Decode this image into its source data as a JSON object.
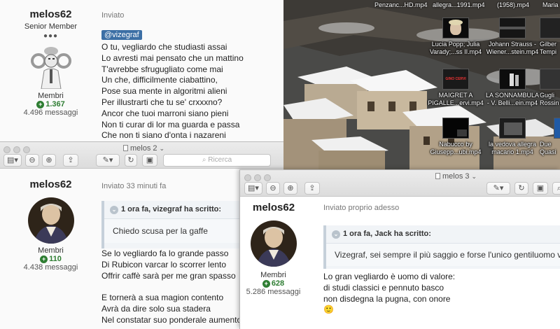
{
  "desktop": {
    "top_labels": [
      "Penzanc...HD.mp4",
      "allegra...1991.mp4",
      "(1958).mp4",
      "Maria"
    ],
    "icons": [
      {
        "label1": "Lucia Popp; Julia",
        "label2": "Varady;...ss II.mp4"
      },
      {
        "label1": "Johann Strauss -",
        "label2": "Wiener...stein.mp4"
      },
      {
        "label1": "Gilber",
        "label2": "Tempi"
      },
      {
        "label1": "MAIGRET A",
        "label2": "PIGALLE...ervi.mp4",
        "thumb_text": "GINO CERVI"
      },
      {
        "label1": "LA SONNAMBULA",
        "label2": "- V. Belli...ein.mp4"
      },
      {
        "label1": "Gugli",
        "label2": "Rossin"
      },
      {
        "label1": "Nabucco by",
        "label2": "Giusepp...ubi.mp4"
      },
      {
        "label1": "la vedova allegra",
        "label2": "macario 1.mp4"
      },
      {
        "label1": "Due",
        "label2": "Quasi"
      }
    ]
  },
  "window1": {
    "username": "melos62",
    "rank": "Senior Member",
    "pips": "●●●",
    "group": "Membri",
    "reputation": "1.367",
    "messages": "4.496 messaggi",
    "sent": "Inviato",
    "mention": "@vizegraf",
    "lines": [
      "O tu, vegliardo che studiasti assai",
      "Lo avresti mai pensato che un mattino",
      "T'avrebbe sfrugugliato come mai",
      "Un che, difficilmente ciabattino,",
      "Pose sua mente in algoritmi alieni",
      "Per illustrarti che tu se' crxxxno?",
      "Ancor che tuoi marroni siano pieni",
      "Non ti curar di lor ma guarda e passa",
      "Che non ti siano d'onta i nazareni"
    ]
  },
  "window2": {
    "title": "melos 2",
    "search": "Ricerca",
    "username": "melos62",
    "group": "Membri",
    "reputation": "110",
    "messages": "4.438 messaggi",
    "sent": "Inviato 33 minuti fa",
    "quote_header": "1 ora fa, vizegraf ha scritto:",
    "quote_body": "Chiedo scusa per la gaffe",
    "lines": [
      "Se lo vegliardo fa lo grande passo",
      "Di Rubicon varcar lo scorrer lento",
      "Offrir caffè sarà per me gran spasso",
      "",
      "E tornerà a sua magion contento",
      "Avrà da dire solo sua stadera",
      "Nel constatar suo ponderale aumento"
    ]
  },
  "window3": {
    "title": "melos 3",
    "username": "melos62",
    "group": "Membri",
    "reputation": "628",
    "messages": "5.286 messaggi",
    "sent": "Inviato proprio adesso",
    "quote_header": "1 ora fa, Jack ha scritto:",
    "quote_body": "Vizegraf, sei sempre il più saggio e forse l'unico gentiluomo vero",
    "lines": [
      "Lo gran vegliardo è uomo di valore:",
      "di studi classici e pennuto basco",
      "non disdegna la pugna, con onore"
    ],
    "emoji": "🙂"
  },
  "colors": {
    "mention_bg": "#3c6fa5",
    "reputation_green": "#2e7d32",
    "quote_bg": "#f1f4f7"
  }
}
